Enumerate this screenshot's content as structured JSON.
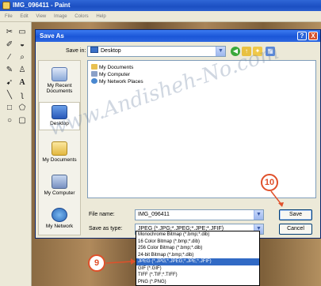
{
  "app": {
    "title": "IMG_096411 - Paint",
    "menu": [
      "File",
      "Edit",
      "View",
      "Image",
      "Colors",
      "Help"
    ]
  },
  "toolbox": {
    "tools": [
      "free-select",
      "rect-select",
      "eraser",
      "fill",
      "picker",
      "magnifier",
      "pencil",
      "brush",
      "airbrush",
      "text",
      "line",
      "curve",
      "rectangle",
      "polygon",
      "ellipse",
      "rounded-rect"
    ]
  },
  "dialog": {
    "title": "Save As",
    "help_label": "?",
    "close_label": "X",
    "save_in_label": "Save in:",
    "save_in_value": "Desktop",
    "places": [
      {
        "label": "My Recent Documents",
        "icon": "recent-documents-icon"
      },
      {
        "label": "Desktop",
        "icon": "desktop-icon"
      },
      {
        "label": "My Documents",
        "icon": "my-documents-icon"
      },
      {
        "label": "My Computer",
        "icon": "my-computer-icon"
      },
      {
        "label": "My Network",
        "icon": "my-network-icon"
      }
    ],
    "files": [
      "My Documents",
      "My Computer",
      "My Network Places"
    ],
    "file_name_label": "File name:",
    "file_name_value": "IMG_096411",
    "save_as_type_label": "Save as type:",
    "save_as_type_value": "JPEG (*.JPG;*.JPEG;*.JPE;*.JFIF)",
    "save_button": "Save",
    "cancel_button": "Cancel"
  },
  "type_options": [
    "Monochrome Bitmap (*.bmp;*.dib)",
    "16 Color Bitmap (*.bmp;*.dib)",
    "256 Color Bitmap (*.bmp;*.dib)",
    "24-bit Bitmap (*.bmp;*.dib)",
    "JPEG (*.JPG;*.JPEG;*.JPE;*.JFIF)",
    "GIF (*.GIF)",
    "TIFF (*.TIF;*.TIFF)",
    "PNG (*.PNG)"
  ],
  "selected_type_index": 4,
  "callouts": {
    "save_step": "10",
    "type_step": "9"
  },
  "watermark": "www.Andisheh-No.com",
  "colors": {
    "accent": "#e0502a",
    "titlebar": "#1a56d8",
    "selection": "#316ac5"
  }
}
